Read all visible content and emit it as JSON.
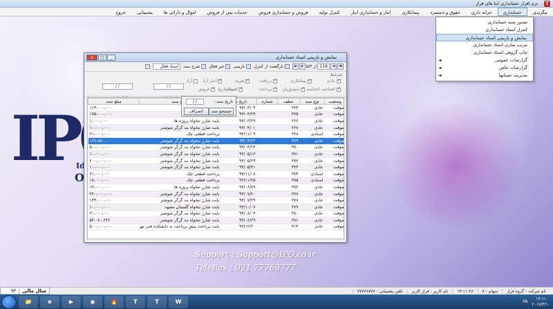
{
  "app": {
    "title": "نرم افزار حسابداری ابنا های فراز",
    "icon_letter": "T",
    "window_controls": [
      "_",
      "□",
      "x"
    ]
  },
  "menubar": {
    "items": [
      {
        "label": "بیگزیدی"
      },
      {
        "label": "حسابداری",
        "active": true
      },
      {
        "label": "خزانه داری"
      },
      {
        "label": "حقوق و دستمزد"
      },
      {
        "label": "پیمانکاری"
      },
      {
        "label": "انبار و حسابداری انبار"
      },
      {
        "label": "کنترل تولید"
      },
      {
        "label": "فروش و حسابداری فروش"
      },
      {
        "label": "خدمات پس از فروش"
      },
      {
        "label": "اموال و دارائی ها"
      },
      {
        "label": "پشتیبانی"
      },
      {
        "label": "خروج"
      }
    ]
  },
  "dropdown": {
    "items": [
      {
        "label": "صدور سند حسابداری",
        "arrow": false,
        "selected": false
      },
      {
        "label": "کنترل اسناد حسابداری",
        "arrow": false,
        "selected": false
      },
      {
        "label": "نمایش و بازبینی اسناد حسابداری",
        "arrow": false,
        "selected": true
      },
      {
        "label": "مرتب سازی اسناد حسابداری",
        "arrow": false,
        "selected": false
      },
      {
        "label": "چاپ گروهی اسناد حسابداری",
        "arrow": false,
        "selected": false
      },
      {
        "label": "گزارشات عمومی",
        "arrow": true,
        "selected": false
      },
      {
        "label": "گزارشات خاص",
        "arrow": true,
        "selected": false
      },
      {
        "label": "مدیریت حسابها",
        "arrow": true,
        "selected": false
      }
    ],
    "arrow_glyph": "◄"
  },
  "window": {
    "title": "نمایش و بازبینی اسناد حسابداری",
    "toolbar": {
      "nav_first": "|◄",
      "nav_prev": "◄",
      "record_current": "116",
      "record_total": "از ۵/۳",
      "nav_next": "►",
      "nav_last": "►|",
      "return_label": "بازگشت از کنترل",
      "review_label": "بازبینی",
      "hide_label": "غیر فعال",
      "show_label": "شرح سند",
      "active_docs_label": "اسناد فعال",
      "print_icon": "print-icon"
    },
    "filters": {
      "group_label": "شرایط",
      "checkboxes": [
        {
          "label": "عادی",
          "checked": true
        },
        {
          "label": "پیمانکاری",
          "checked": true
        },
        {
          "label": "دریافت",
          "checked": true
        },
        {
          "label": "هزینه",
          "checked": true
        },
        {
          "label": "انبار آزاد",
          "checked": true
        },
        {
          "label": "آزاد",
          "checked": false
        },
        {
          "label": "افتتاحیه، اختتامیه",
          "checked": true
        },
        {
          "label": "سودوزیان",
          "checked": true
        },
        {
          "label": "پرداخت",
          "checked": true
        },
        {
          "label": "اسنادی",
          "checked": true
        },
        {
          "label": "فروش",
          "checked": true
        }
      ],
      "date_filter_label": "شرط تاریخ",
      "from_date_label": "از تاریخ :",
      "to_date_label": "تا تاریخ :",
      "from_date_value": "/ /",
      "to_date_value": "/ /"
    },
    "dialog": {
      "date_label": "تاریخ سند :",
      "date_value": "/ /",
      "search_button": "جستجو سند",
      "cancel_button": "انصراف"
    },
    "table": {
      "columns": [
        "وضعیت",
        "نوع سند",
        "عطف",
        "شماره",
        "تاریخ سند",
        "شرح سند",
        "مبلغ سند"
      ],
      "rows": [
        [
          "موقت",
          "عادی",
          "۳۶۴",
          "",
          "۹۳/۰۳/۰۹",
          "باب",
          "۱۱۴،۰۰۰،۰۰۰"
        ],
        [
          "موقت",
          "عادی",
          "۳۶۵",
          "",
          "۹۳/۰۳/۲۹",
          "باب",
          "۱۷۵،۰۰۰،۰۰۰"
        ],
        [
          "موقت",
          "عادی",
          "۳۶۶",
          "",
          "۹۳/۰۳/۲۹",
          "بابت شارژ تنخواه پروژه ها",
          "۱،۰۰۰،۰۰۰"
        ],
        [
          "موقت",
          "عادی",
          "۳۶۷",
          "",
          "۹۳/۰۴/۰۱",
          "بابت شارژ تنخواه بند گرگر شوشتر",
          "۱۰،۰۰۰،۰۰۰"
        ],
        [
          "موقت",
          "اسنادی",
          "۳۶۸",
          "",
          "۹۳/۱۱/۰۹",
          "پرداخت قطعی چک",
          "۲۱،۰۰۰،۰۰۰"
        ],
        [
          "موقت",
          "عادی",
          "۳۶۹",
          "",
          "۹۳/۰۴/۲۲",
          "بابت شارژ تنخواه بند گرگر شوشتر",
          "۱۳۸،۷۵۰،۰۰۰"
        ],
        [
          "موقت",
          "عادی",
          "۳۷۰",
          "",
          "۹۳/۰۴/۲۳",
          "بابت شارژ تنخواه بند گرگر شوشتر",
          "۵۰،۰۰۰،۰۰۰"
        ],
        [
          "موقت",
          "عادی",
          "۳۷۱",
          "",
          "۹۳/۰۵/۱۳",
          "بابت شارژ تنخواه بند گرگر شوشتر",
          "۱۰،۰۰۰،۰۰۰"
        ],
        [
          "موقت",
          "عادی",
          "۳۷۲",
          "",
          "۹۳/۰۵/۲۹",
          "بابت شارژ تنخواه بند گرگر شوشتر",
          "۲۰۰،۰۰۰،۰۰۰"
        ],
        [
          "موقت",
          "عادی",
          "۳۷۳",
          "",
          "۹۳/۰۵/۳۱",
          "بابت شارژ تنخواه بند گرگر شوشتر",
          "۱۰،۰۰۰،۰۰۰"
        ],
        [
          "موقت",
          "اسنادی",
          "۳۷۴",
          "",
          "۹۳/۱۱/۰۸",
          "پرداخت قطعی چک",
          "۳۱،۰۰۰،۰۰۰"
        ],
        [
          "موقت",
          "اسنادی",
          "۳۷۵",
          "",
          "۹۳/۱۱/۲۵",
          "پرداخت قطعی چک",
          "۱۷،۰۰۰،۰۰۰"
        ],
        [
          "موقت",
          "عادی",
          "۳۷۶",
          "",
          "۹۳/۰۶/۲۹",
          "بابت شارژ تنخواه پروژه ها",
          "۱۴،۰۰۰،۰۰۰"
        ],
        [
          "موقت",
          "عادی",
          "۳۷۷",
          "",
          "۹۳/۰۷/۲۰",
          "بابت شارژ تنخواه بند گرگر شوشتر",
          "۲۴۰،۰۰۰،۰۰۰"
        ],
        [
          "موقت",
          "عادی",
          "۳۷۸",
          "",
          "۹۳/۰۷/۲۹",
          "بابت شارژ تنخواه بند گرگر شوشتر",
          "۱۳۳،۰۰۰،۰۰۰"
        ],
        [
          "موقت",
          "عادی",
          "۳۷۹",
          "",
          "۹۳/۱۰/۰۷",
          "بابت شارژ تنخواه گلستان مشهد",
          "۱۰،۰۰۰،۰۰۰"
        ],
        [
          "موقت",
          "عادی",
          "۳۸۰",
          "",
          "۹۳/۰۸/۰۴",
          "بابت شارژ تنخواه بند گرگر شوشتر",
          "۳۰،۰۰۰،۰۰۰"
        ],
        [
          "موقت",
          "عادی",
          "۳۸۱",
          "",
          "۹۳/۰۸/۲۹",
          "بابت شارژ تنخواه بند گرگر شوشتر",
          "۵۴،۰۸۰،۶۴۶"
        ],
        [
          "موقت",
          "عادی",
          "۴۱۴",
          "",
          "۹۳/۱۲/۲۰",
          "بابت پرداخت پیش پرداخت به دانشکده فنی تهران",
          "۵۰۰،۰۰۰،۰۰۰"
        ]
      ],
      "selected_row": 5,
      "row_markers": {
        "4": "*",
        "10": "*",
        "11": "*"
      }
    }
  },
  "branding": {
    "logo_letters": "IPO",
    "logo_fragment_1": "Ide",
    "logo_fragment_2": "Os",
    "support": "Support : Support@IPO.co.ir",
    "telefax": "TeleFax : 021 77768777"
  },
  "statusbar": {
    "year_label": "سال مالی",
    "year_value": "۹۳",
    "cells": [
      "نام شرکت : گروه فراز",
      "سهام : ۸",
      "۱۴:۱۱:۲۸",
      "نام کاربر : فراز کاربر",
      "تلفن پشتیبانی : ۷۷۷۶۸۷۷۷"
    ]
  },
  "taskbar": {
    "apps": [
      "📁",
      "e",
      "▶",
      "◉",
      "🔥",
      "T",
      "T",
      "W"
    ],
    "lang": "FA",
    "time": "۱۴:۱۱",
    "date": "۲۰۱۷/۳/۱۰"
  },
  "colors": {
    "accent": "#2f7ad8",
    "logo_blue": "#1e2a63"
  }
}
